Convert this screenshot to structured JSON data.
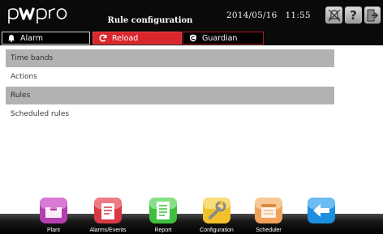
{
  "header": {
    "logo_text": "pwpro",
    "title": "Rule configuration",
    "date": "2014/05/16",
    "time": "11:55",
    "icons": [
      "alarm-mute-icon",
      "help-icon",
      "exit-icon"
    ]
  },
  "tabs": [
    {
      "label": "Alarm",
      "icon": "bell-icon"
    },
    {
      "label": "Reload",
      "icon": "reload-icon"
    },
    {
      "label": "Guardian",
      "icon": "guardian-icon"
    }
  ],
  "list": {
    "items": [
      {
        "label": "Time bands"
      },
      {
        "label": "Actions"
      },
      {
        "label": "Rules"
      },
      {
        "label": "Scheduled rules"
      }
    ]
  },
  "dock": {
    "items": [
      {
        "label": "Plant",
        "icon": "plant-icon"
      },
      {
        "label": "Alarms/Events",
        "icon": "alarms-events-icon"
      },
      {
        "label": "Report",
        "icon": "report-icon"
      },
      {
        "label": "Configuration",
        "icon": "configuration-icon"
      },
      {
        "label": "Scheduler",
        "icon": "scheduler-icon"
      },
      {
        "label": "",
        "icon": "back-arrow-icon"
      }
    ]
  },
  "colors": {
    "header_bg": "#0a0a0a",
    "reload_tab": "#d8262b",
    "shaded_row": "#b2b2b2",
    "plant": "#b43fae",
    "alarms": "#d73a45",
    "report": "#3fbf3f",
    "configuration": "#f2c12a",
    "scheduler": "#f0a25a",
    "back": "#1e8ee0"
  }
}
